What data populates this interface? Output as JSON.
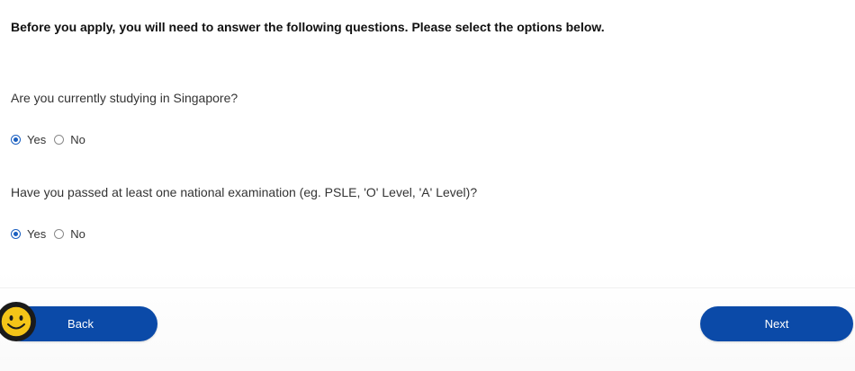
{
  "intro": "Before you apply, you will need to answer the following questions. Please select the options below.",
  "questions": [
    {
      "text": "Are you currently studying in Singapore?",
      "options": [
        "Yes",
        "No"
      ],
      "selected": "Yes"
    },
    {
      "text": "Have you passed at least one national examination (eg. PSLE, 'O' Level, 'A' Level)?",
      "options": [
        "Yes",
        "No"
      ],
      "selected": "Yes"
    }
  ],
  "buttons": {
    "back": "Back",
    "next": "Next"
  },
  "colors": {
    "primary": "#0b4aa8",
    "radio_checked": "#1a5fc0",
    "smiley_face": "#f5c518"
  },
  "icons": {
    "feedback": "smiley-face-icon"
  }
}
